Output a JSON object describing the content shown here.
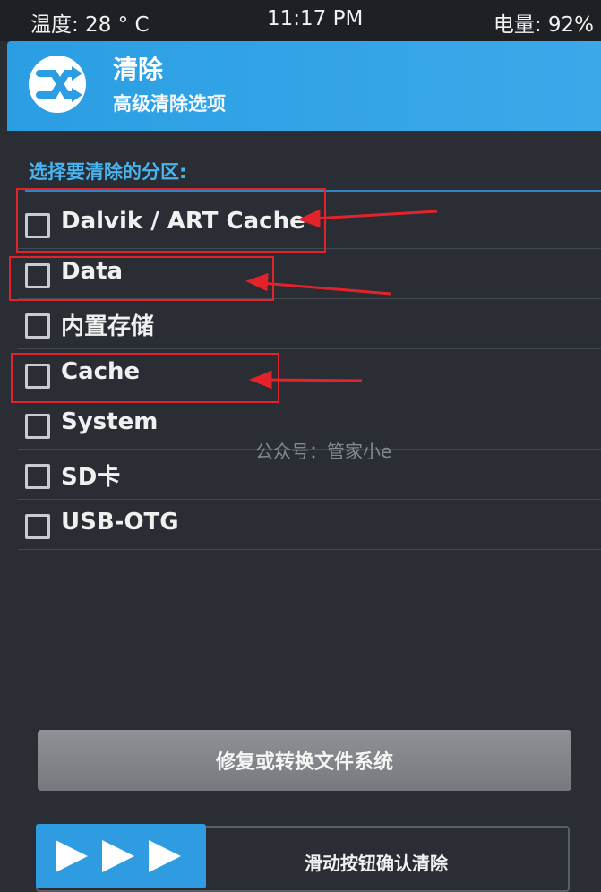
{
  "status": {
    "temperature": "温度: 28 ° C",
    "time": "11:17 PM",
    "battery": "电量: 92%"
  },
  "header": {
    "logo_icon": "twrp-logo-icon",
    "title": "清除",
    "subtitle": "高级清除选项"
  },
  "section": {
    "title": "选择要清除的分区:"
  },
  "partitions": [
    {
      "label": "Dalvik / ART Cache",
      "checked": false,
      "highlighted": true
    },
    {
      "label": "Data",
      "checked": false,
      "highlighted": true
    },
    {
      "label": "内置存储",
      "checked": false,
      "highlighted": false
    },
    {
      "label": "Cache",
      "checked": false,
      "highlighted": true
    },
    {
      "label": "System",
      "checked": false,
      "highlighted": false
    },
    {
      "label": "SD卡",
      "checked": false,
      "highlighted": false
    },
    {
      "label": "USB-OTG",
      "checked": false,
      "highlighted": false
    }
  ],
  "watermark": "公众号：管家小e",
  "buttons": {
    "repair": "修复或转换文件系统",
    "swipe_label": "滑动按钮确认清除"
  },
  "colors": {
    "accent": "#2b9ee3",
    "highlight": "#e3232b",
    "background": "#2a2d33"
  }
}
